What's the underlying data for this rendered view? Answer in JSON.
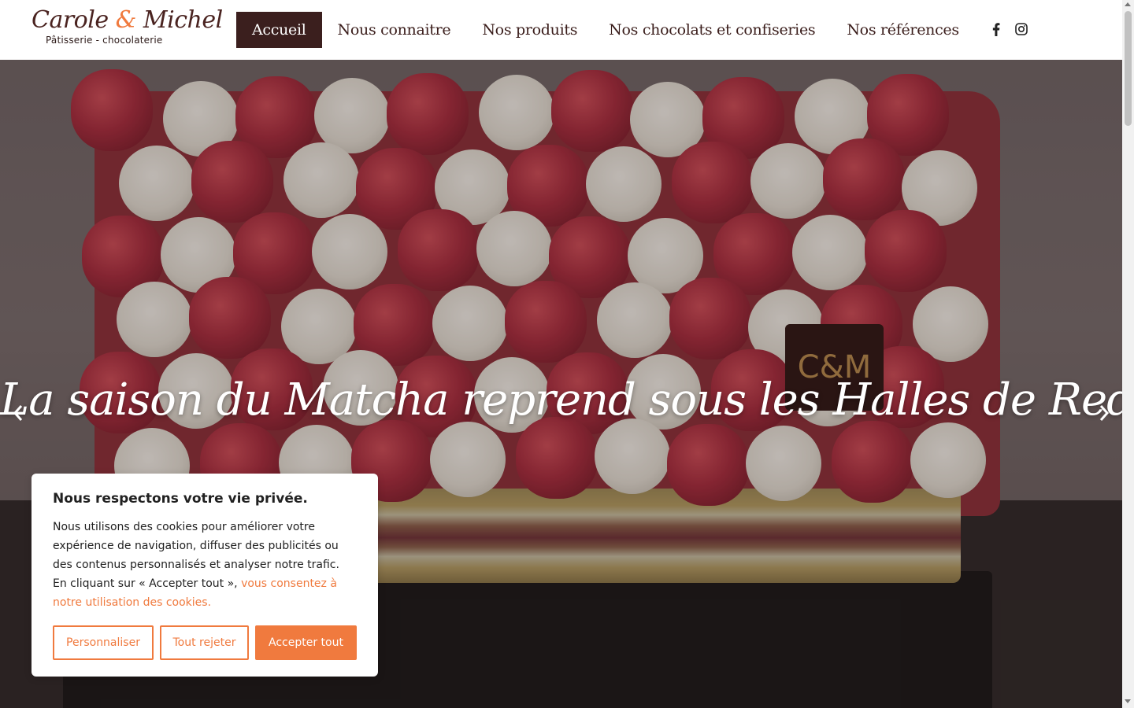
{
  "header": {
    "logo_script_part1": "Carole ",
    "logo_amp": "&",
    "logo_script_part2": " Michel",
    "logo_subtitle": "Pâtisserie - chocolaterie"
  },
  "nav": {
    "items": [
      {
        "label": "Accueil",
        "active": true
      },
      {
        "label": "Nous connaitre",
        "active": false
      },
      {
        "label": "Nos produits",
        "active": false
      },
      {
        "label": "Nos chocolats et confiseries",
        "active": false
      },
      {
        "label": "Nos références",
        "active": false
      }
    ],
    "active_bg": "#3b1f1e"
  },
  "social": {
    "icons": [
      "facebook-icon",
      "instagram-icon"
    ]
  },
  "hero": {
    "title": "La saison du Matcha reprend sous les Halles de Redon",
    "plaque_text": "C&M",
    "prev_icon": "chevron-left-icon",
    "next_icon": "chevron-right-icon"
  },
  "cookie": {
    "title": "Nous respectons votre vie privée.",
    "text_before_link": "Nous utilisons des cookies pour améliorer votre expérience de navigation, diffuser des publicités ou des contenus personnalisés et analyser notre trafic. En cliquant sur « Accepter tout », ",
    "link_text": "vous consentez à notre utilisation des cookies.",
    "btn_customize": "Personnaliser",
    "btn_reject": "Tout rejeter",
    "btn_accept": "Accepter tout",
    "accent": "#f07a3e"
  }
}
